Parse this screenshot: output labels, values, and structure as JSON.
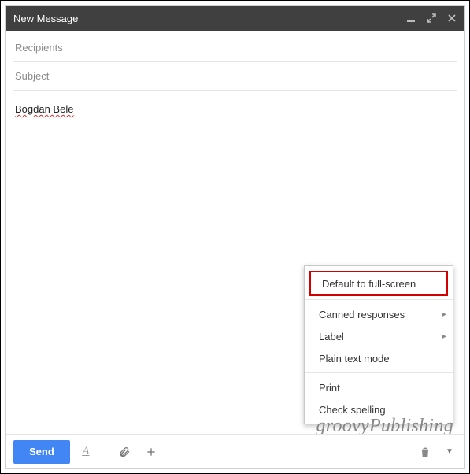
{
  "header": {
    "title": "New Message"
  },
  "fields": {
    "recipients_placeholder": "Recipients",
    "recipients_value": "",
    "subject_placeholder": "Subject",
    "subject_value": ""
  },
  "body": {
    "content": "Bogdan Bele"
  },
  "toolbar": {
    "send_label": "Send"
  },
  "menu": {
    "default_fullscreen": "Default to full-screen",
    "canned_responses": "Canned responses",
    "label": "Label",
    "plain_text": "Plain text mode",
    "print": "Print",
    "check_spelling": "Check spelling"
  },
  "watermark": "groovyPublishing"
}
